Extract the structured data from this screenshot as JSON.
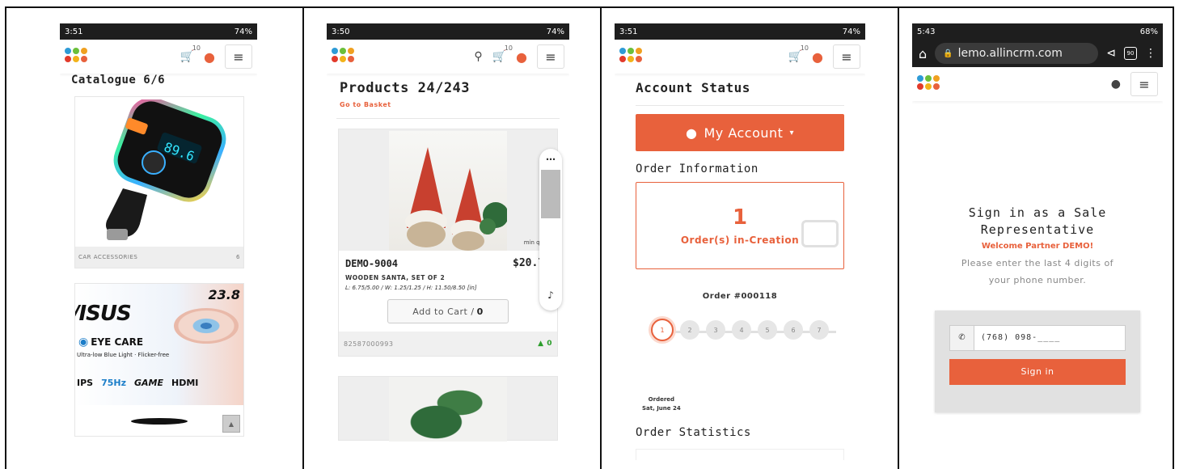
{
  "panel1": {
    "status": {
      "time": "3:51",
      "right": "74%"
    },
    "nav": {
      "cart_count": "10"
    },
    "catalogue_title": "Catalogue 6/6",
    "items": [
      {
        "display": "89.6",
        "category": "CAR ACCESSORIES",
        "count": "6"
      },
      {
        "brand": "/ISUS",
        "size": "23.8",
        "feature": "EYE CARE",
        "feature_sub": "Ultra-low Blue Light · Flicker-free",
        "specs": [
          "IPS",
          "75Hz",
          "GAME",
          "HDMI"
        ]
      }
    ]
  },
  "panel2": {
    "status": {
      "time": "3:50",
      "right": "74%"
    },
    "nav": {
      "cart_count": "10"
    },
    "title": "Products 24/243",
    "go_basket": "Go to Basket",
    "product": {
      "sku": "DEMO-9004",
      "price": "$20.75",
      "name": "WOODEN SANTA, SET OF 2",
      "dims": "L: 6.75/5.00 / W: 1.25/1.25 / H: 11.50/8.50 [in]",
      "min_qty": "min qty: 2",
      "add_to_cart": "Add to Cart /",
      "cart_qty": "0",
      "barcode": "82587000993",
      "stock": "0"
    }
  },
  "panel3": {
    "status": {
      "time": "3:51",
      "right": "74%"
    },
    "nav": {
      "cart_count": "10"
    },
    "title": "Account Status",
    "my_account": "My Account",
    "order_info_h": "Order Information",
    "order_count": "1",
    "order_label": "Order(s) in-Creation",
    "order_no": "Order #000118",
    "steps": [
      "1",
      "2",
      "3",
      "4",
      "5",
      "6",
      "7"
    ],
    "step_caption_1": "Ordered",
    "step_caption_2": "Sat, June 24",
    "stats_h": "Order Statistics"
  },
  "panel4": {
    "status": {
      "time": "5:43",
      "right": "68%"
    },
    "url": "lemo.allincrm.com",
    "tabs": "90",
    "heading_1": "Sign in as a Sale",
    "heading_2": "Representative",
    "welcome": "Welcome Partner DEMO!",
    "please_1": "Please enter the last 4 digits of",
    "please_2": "your phone number.",
    "phone_value": "(768) 098-____",
    "sign_in": "Sign in"
  },
  "colors": {
    "accent": "#e8613c",
    "stock_green": "#2a9d2a"
  }
}
